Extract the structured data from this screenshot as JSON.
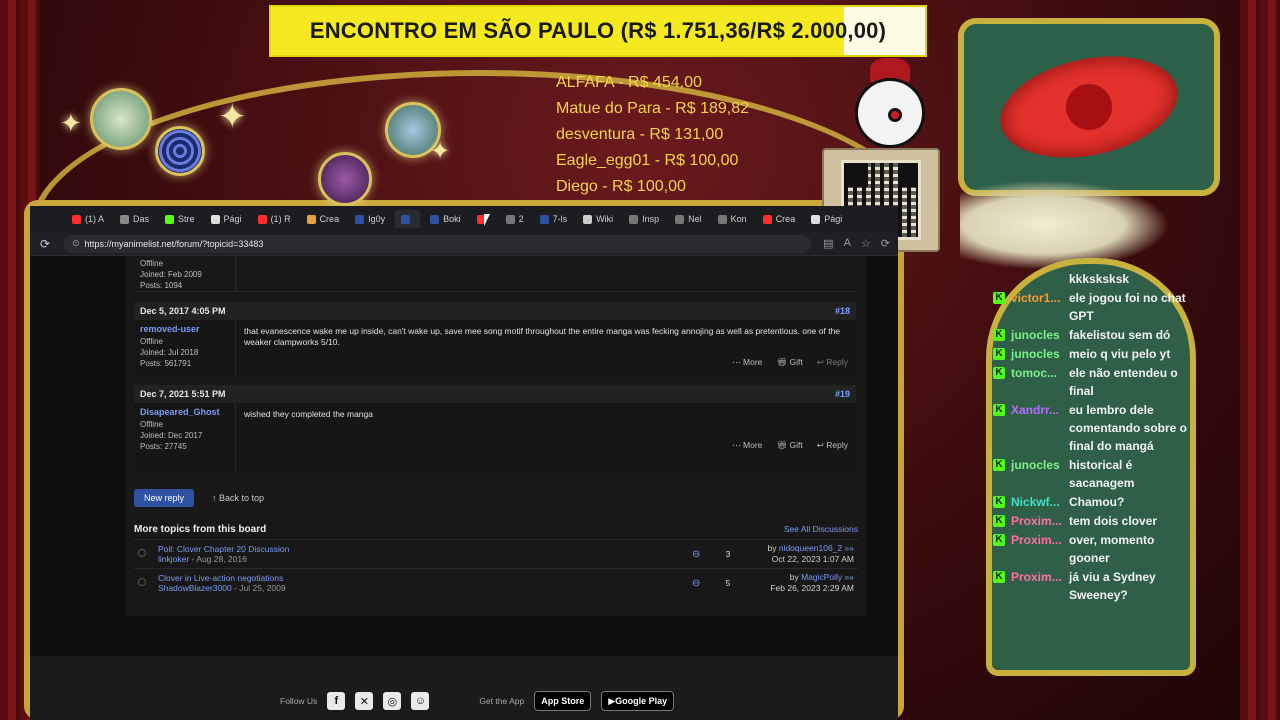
{
  "overlay": {
    "goal_text": "ENCONTRO EM SÃO PAULO (R$ 1.751,36/R$ 2.000,00)",
    "goal_progress": 0.8757,
    "donors": [
      "ALFAFA - R$ 454,00",
      "Matue do Para - R$ 189,82",
      "desventura - R$ 131,00",
      "Eagle_egg01 - R$ 100,00",
      "Diego - R$ 100,00"
    ],
    "colors": {
      "goal_bg": "#f4ea1f",
      "donor_text": "#f2d44a",
      "frame_gold": "#c9a53a",
      "chat_bg": "#2f5f47",
      "badge": "#53fc18"
    }
  },
  "browser": {
    "tabs": [
      {
        "label": "(1) A",
        "icon": "youtube-icon",
        "color": "#ff2d2d"
      },
      {
        "label": "Das",
        "icon": "site-icon",
        "color": "#888888"
      },
      {
        "label": "Stre",
        "icon": "kick-icon",
        "color": "#53fc18"
      },
      {
        "label": "Pági",
        "icon": "x-icon",
        "color": "#dddddd"
      },
      {
        "label": "(1) R",
        "icon": "youtube-icon",
        "color": "#ff2d2d"
      },
      {
        "label": "Crea",
        "icon": "site-icon",
        "color": "#e8a23a"
      },
      {
        "label": "Ig0y",
        "icon": "mal-icon",
        "color": "#2e51a2"
      },
      {
        "label": "",
        "icon": "mal-icon",
        "color": "#2e51a2",
        "active": true
      },
      {
        "label": "Boki",
        "icon": "mal-icon",
        "color": "#2e51a2"
      },
      {
        "label": "",
        "icon": "youtube-icon",
        "color": "#ff2d2d"
      },
      {
        "label": "2",
        "icon": "site-icon",
        "color": "#777777"
      },
      {
        "label": "7-ls",
        "icon": "mal-icon",
        "color": "#2e51a2"
      },
      {
        "label": "Wiki",
        "icon": "site-icon",
        "color": "#cccccc"
      },
      {
        "label": "Insp",
        "icon": "site-icon",
        "color": "#777777"
      },
      {
        "label": "Nel",
        "icon": "site-icon",
        "color": "#777777"
      },
      {
        "label": "Kon",
        "icon": "site-icon",
        "color": "#777777"
      },
      {
        "label": "Crea",
        "icon": "youtube-icon",
        "color": "#ff2d2d"
      },
      {
        "label": "Pági",
        "icon": "x-icon",
        "color": "#dddddd"
      }
    ],
    "url": "https://myanimelist.net/forum/?topicid=33483"
  },
  "forum": {
    "prev_post": {
      "status": "Offline",
      "joined": "Joined: Feb 2009",
      "posts": "Posts: 1094"
    },
    "posts": [
      {
        "date": "Dec 5, 2017 4:05 PM",
        "number": "#18",
        "user": "removed-user",
        "status": "Offline",
        "joined": "Joined: Jul 2018",
        "posts": "Posts: 561791",
        "text": "that evanescence wake me up inside, can't wake up, save mee song motif throughout the entire manga was fecking annojing as well as pretentious. one of the weaker clampworks 5/10."
      },
      {
        "date": "Dec 7, 2021 5:51 PM",
        "number": "#19",
        "user": "Disapeared_Ghost",
        "status": "Offline",
        "joined": "Joined: Dec 2017",
        "posts": "Posts: 27745",
        "text": "wished they completed the manga"
      }
    ],
    "actions": {
      "more": "More",
      "gift": "Gift",
      "reply": "Reply"
    },
    "new_reply": "New reply",
    "back_to_top": "Back to top",
    "more_topics_title": "More topics from this board",
    "see_all": "See All Discussions",
    "topics": [
      {
        "title": "Poll: Clover Chapter 20 Discussion",
        "author": "linkjoker",
        "date": " - Aug 28, 2016",
        "replies": "3",
        "last_by": "by ",
        "last_user": "nidoqueen106_2 »»",
        "last_date": "Oct 22, 2023 1:07 AM"
      },
      {
        "title": "Clover in Live-action negotiations",
        "author": "ShadowBlazer3000",
        "date": " - Jul 25, 2009",
        "replies": "5",
        "last_by": "by ",
        "last_user": "MagicPolly »»",
        "last_date": "Feb 26, 2023 2:29 AM"
      }
    ],
    "footer": {
      "follow_us": "Follow Us",
      "get_app": "Get the App",
      "app_store": "App Store",
      "google_play": "Google Play"
    }
  },
  "chat": [
    {
      "user": "",
      "text": "kkksksksk",
      "color": "#ffffff",
      "badge": false
    },
    {
      "user": "victor1...",
      "text": "ele jogou foi no chat GPT",
      "color": "#ff9a2e",
      "badge": true
    },
    {
      "user": "junocles",
      "text": "fakelistou sem dó",
      "color": "#7cf08a",
      "badge": true
    },
    {
      "user": "junocles",
      "text": "meio q viu pelo yt",
      "color": "#7cf08a",
      "badge": true
    },
    {
      "user": "tomoc...",
      "text": "ele não entendeu o final",
      "color": "#7cf08a",
      "badge": true
    },
    {
      "user": "Xandrr...",
      "text": "eu lembro dele comentando sobre o final do mangá",
      "color": "#b36bff",
      "badge": true
    },
    {
      "user": "junocles",
      "text": "historical é sacanagem",
      "color": "#7cf08a",
      "badge": true
    },
    {
      "user": "Nickwf...",
      "text": "Chamou?",
      "color": "#3ee0c8",
      "badge": true
    },
    {
      "user": "Proxim...",
      "text": "tem dois clover",
      "color": "#ff6fa3",
      "badge": true
    },
    {
      "user": "Proxim...",
      "text": "over, momento gooner",
      "color": "#ff6fa3",
      "badge": true
    },
    {
      "user": "Proxim...",
      "text": "já viu a Sydney Sweeney?",
      "color": "#ff6fa3",
      "badge": true
    }
  ]
}
